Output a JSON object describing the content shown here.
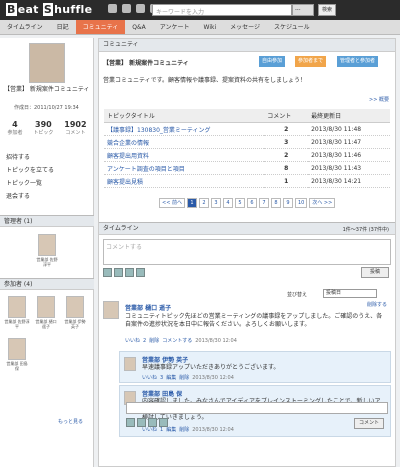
{
  "app": {
    "logo_prefix": "B",
    "logo_text": "eat ",
    "logo_prefix2": "S",
    "logo_text2": "huffle"
  },
  "header": {
    "search_placeholder": "キーワードを入力",
    "select_value": "---",
    "search_button": "検索"
  },
  "nav": [
    "タイムライン",
    "日記",
    "コミュニティ",
    "Q&A",
    "アンケート",
    "Wiki",
    "メッセージ",
    "スケジュール"
  ],
  "profile": {
    "name": "【営業】  新規案件コミュニティ",
    "created": "作成日：2011/10/27 19:34",
    "stats": [
      {
        "n": "4",
        "l": "参加者"
      },
      {
        "n": "390",
        "l": "トピック"
      },
      {
        "n": "1902",
        "l": "コメント"
      }
    ]
  },
  "leftmenu": [
    "招待する",
    "トピックを立てる",
    "トピック一覧",
    "退会する"
  ],
  "admins": {
    "title": "管理者 (1)",
    "people": [
      "営業部 佐野 淳平"
    ]
  },
  "members": {
    "title": "参加者 (4)",
    "people": [
      "営業部 佐野淳平",
      "営業部 樋口 遥子",
      "営業部 伊勢 英子",
      "営業部 田島 保"
    ],
    "more": "もっと見る"
  },
  "community": {
    "section": "コミュニティ",
    "name": "【営業】 新規案件コミュニティ",
    "btn_join": "自由参加",
    "btn_self": "参加者まで",
    "btn_admin": "管理者と参加者",
    "desc": "営業コミュニティです。顧客情報や議事録、提案資料の共有をしましょう！",
    "overview": ">> 概要"
  },
  "topics": {
    "headers": [
      "トピックタイトル",
      "コメント",
      "最終更新日"
    ],
    "rows": [
      [
        "【議事録】130830_営業ミーティング",
        "2",
        "2013/8/30 11:48"
      ],
      [
        "競合企業の情報",
        "3",
        "2013/8/30 11:47"
      ],
      [
        "顧客提出用資料",
        "2",
        "2013/8/30 11:46"
      ],
      [
        "アンケート調査の項目と項目",
        "8",
        "2013/8/30 11:43"
      ],
      [
        "顧客提出見積",
        "1",
        "2013/8/30 14:21"
      ]
    ]
  },
  "pager": [
    "<< 前へ",
    "1",
    "2",
    "3",
    "4",
    "5",
    "6",
    "7",
    "8",
    "9",
    "10",
    "次へ >>"
  ],
  "timeline": {
    "title": "タイムライン",
    "count": "1件～37件 (37件中)",
    "placeholder": "コメントする",
    "post": "投稿",
    "sort_label": "並び替え",
    "sort_value": "投稿日",
    "delete": "削除する"
  },
  "post": {
    "author": "営業部 樋口 遥子",
    "text": "コミュニティトピック先ほどの営業ミーティングの議事録をアップしました。ご確認のうえ、各自案件の進捗状況を本日中に報告ください。よろしくお願いします。",
    "meta": [
      "いいね",
      "2",
      "削除",
      "コメントする"
    ],
    "date": "2013/8/30 12:04"
  },
  "replies": [
    {
      "author": "営業部 伊勢 英子",
      "text": "早速議事録アップいただきありがとうございます。",
      "meta": [
        "いいね",
        "3",
        "編集",
        "削除"
      ],
      "date": "2013/8/30 12:04"
    },
    {
      "author": "営業部 田島 保",
      "text": "内容確認しました。みなさんでアイディアをブレインストーミングしたことで、新しいアプローチや発見がたくさん生まれることを実感しました。今回出た案顧客への提案の中で検討していきましょう。",
      "meta": [
        "いいね",
        "1",
        "編集",
        "削除"
      ],
      "date": "2013/8/30 12:04"
    }
  ],
  "reply_button": "コメント"
}
